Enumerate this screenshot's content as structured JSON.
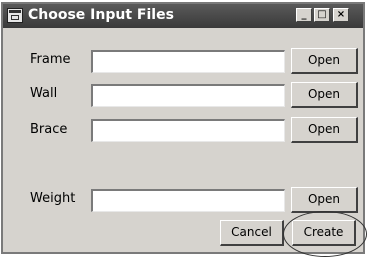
{
  "window": {
    "title": "Choose Input Files",
    "controls": {
      "minimize": "_",
      "maximize": "□",
      "close": "×"
    }
  },
  "rows": [
    {
      "label": "Frame",
      "value": "",
      "button": "Open"
    },
    {
      "label": "Wall",
      "value": "",
      "button": "Open"
    },
    {
      "label": "Brace",
      "value": "",
      "button": "Open"
    },
    {
      "label": "Weight",
      "value": "",
      "button": "Open"
    }
  ],
  "actions": {
    "cancel": "Cancel",
    "create": "Create"
  },
  "icons": [
    "app-icon",
    "minimize-icon",
    "maximize-icon",
    "close-icon"
  ]
}
